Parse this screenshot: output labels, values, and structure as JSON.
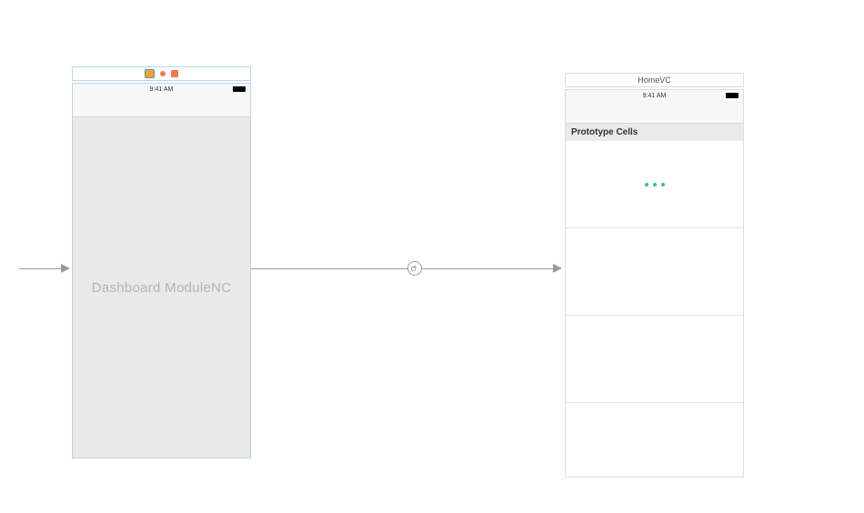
{
  "left_screen": {
    "status_time": "9:41 AM",
    "placeholder": "Dashboard ModuleNC"
  },
  "right_screen": {
    "title": "HomeVC",
    "status_time": "9:41 AM",
    "section_header": "Prototype Cells"
  },
  "icons": {
    "nav_controller": "nav-controller-icon",
    "first_responder": "first-responder-icon",
    "exit": "exit-icon"
  }
}
